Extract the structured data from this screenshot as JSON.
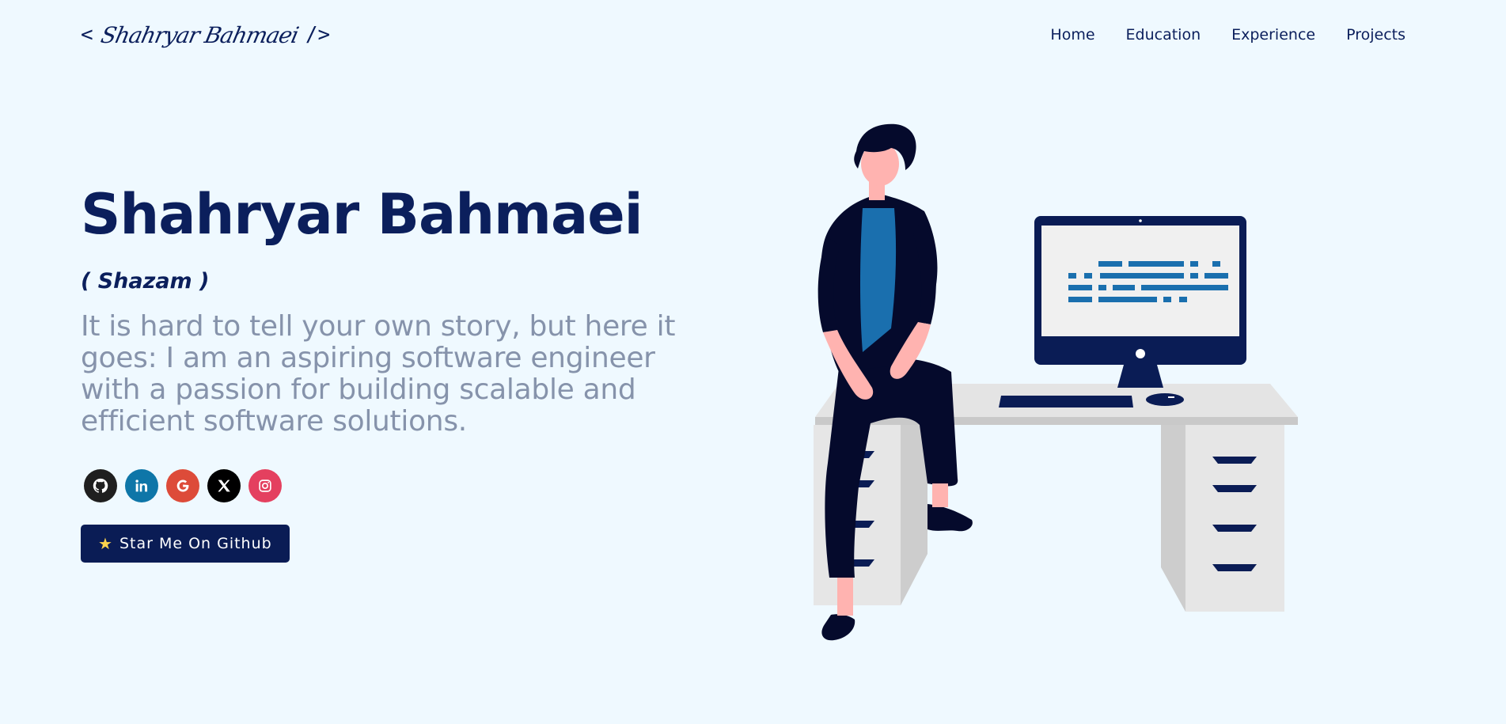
{
  "header": {
    "logo": {
      "open": "<",
      "signature": "Shahryar Bahmaei",
      "close": "/>"
    },
    "nav": [
      {
        "label": "Home"
      },
      {
        "label": "Education"
      },
      {
        "label": "Experience"
      },
      {
        "label": "Projects"
      }
    ]
  },
  "hero": {
    "name": "Shahryar Bahmaei",
    "nickname": "( Shazam )",
    "tagline": "It is hard to tell your own story, but here it goes: I am an aspiring software engineer with a passion for building scalable and efficient software solutions.",
    "socials": [
      {
        "icon": "github-icon",
        "color": "#1f1f1f"
      },
      {
        "icon": "linkedin-icon",
        "color": "#0e76a8"
      },
      {
        "icon": "google-icon",
        "color": "#dd4b39"
      },
      {
        "icon": "x-icon",
        "color": "#000000"
      },
      {
        "icon": "instagram-icon",
        "color": "#e4405f"
      }
    ],
    "star_button": {
      "icon": "star-icon",
      "label": "Star Me On Github"
    }
  },
  "colors": {
    "background": "#eff9ff",
    "primary": "#0b1f5c",
    "muted_text": "#8693ab",
    "button": "#0a1c55"
  }
}
